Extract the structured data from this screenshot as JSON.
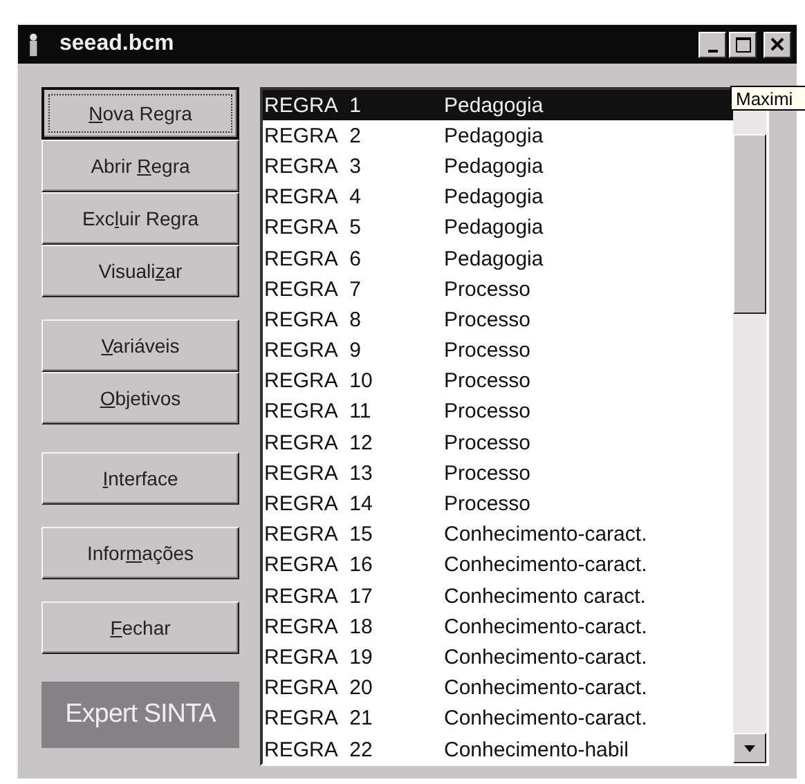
{
  "window": {
    "title": "seead.bcm"
  },
  "button_groups": [
    {
      "buttons": [
        {
          "key": "N",
          "after": "ova Regra",
          "focused": true
        },
        {
          "before": "Abrir ",
          "key": "R",
          "after": "egra",
          "focused": false
        },
        {
          "before": "Exc",
          "key": "l",
          "after": "uir Regra",
          "focused": false
        },
        {
          "before": "Visuali",
          "key": "z",
          "after": "ar",
          "focused": false
        }
      ]
    },
    {
      "buttons": [
        {
          "key": "V",
          "after": "ariáveis",
          "focused": false
        },
        {
          "key": "O",
          "after": "bjetivos",
          "focused": false
        }
      ]
    },
    {
      "buttons": [
        {
          "key": "I",
          "after": "nterface",
          "focused": false
        }
      ]
    },
    {
      "buttons": [
        {
          "before": "Infor",
          "key": "m",
          "after": "ações",
          "focused": false
        }
      ]
    },
    {
      "buttons": [
        {
          "key": "F",
          "after": "echar",
          "focused": false
        }
      ]
    }
  ],
  "logo": "Expert SINTA",
  "rules": [
    {
      "name": "REGRA",
      "number": "1",
      "category": "Pedagogia",
      "selected": true
    },
    {
      "name": "REGRA",
      "number": "2",
      "category": "Pedagogia",
      "selected": false
    },
    {
      "name": "REGRA",
      "number": "3",
      "category": "Pedagogia",
      "selected": false
    },
    {
      "name": "REGRA",
      "number": "4",
      "category": "Pedagogia",
      "selected": false
    },
    {
      "name": "REGRA",
      "number": "5",
      "category": "Pedagogia",
      "selected": false
    },
    {
      "name": "REGRA",
      "number": "6",
      "category": "Pedagogia",
      "selected": false
    },
    {
      "name": "REGRA",
      "number": "7",
      "category": "Processo",
      "selected": false
    },
    {
      "name": "REGRA",
      "number": "8",
      "category": "Processo",
      "selected": false
    },
    {
      "name": "REGRA",
      "number": "9",
      "category": "Processo",
      "selected": false
    },
    {
      "name": "REGRA",
      "number": "10",
      "category": "Processo",
      "selected": false
    },
    {
      "name": "REGRA",
      "number": "11",
      "category": "Processo",
      "selected": false
    },
    {
      "name": "REGRA",
      "number": "12",
      "category": "Processo",
      "selected": false
    },
    {
      "name": "REGRA",
      "number": "13",
      "category": "Processo",
      "selected": false
    },
    {
      "name": "REGRA",
      "number": "14",
      "category": "Processo",
      "selected": false
    },
    {
      "name": "REGRA",
      "number": "15",
      "category": "Conhecimento-caract.",
      "selected": false
    },
    {
      "name": "REGRA",
      "number": "16",
      "category": "Conhecimento-caract.",
      "selected": false
    },
    {
      "name": "REGRA",
      "number": "17",
      "category": "Conhecimento caract.",
      "selected": false
    },
    {
      "name": "REGRA",
      "number": "18",
      "category": "Conhecimento-caract.",
      "selected": false
    },
    {
      "name": "REGRA",
      "number": "19",
      "category": "Conhecimento-caract.",
      "selected": false
    },
    {
      "name": "REGRA",
      "number": "20",
      "category": "Conhecimento-caract.",
      "selected": false
    },
    {
      "name": "REGRA",
      "number": "21",
      "category": "Conhecimento-caract.",
      "selected": false
    },
    {
      "name": "REGRA",
      "number": "22",
      "category": "Conhecimento-habil",
      "selected": false
    }
  ],
  "tooltip": "Maximi"
}
